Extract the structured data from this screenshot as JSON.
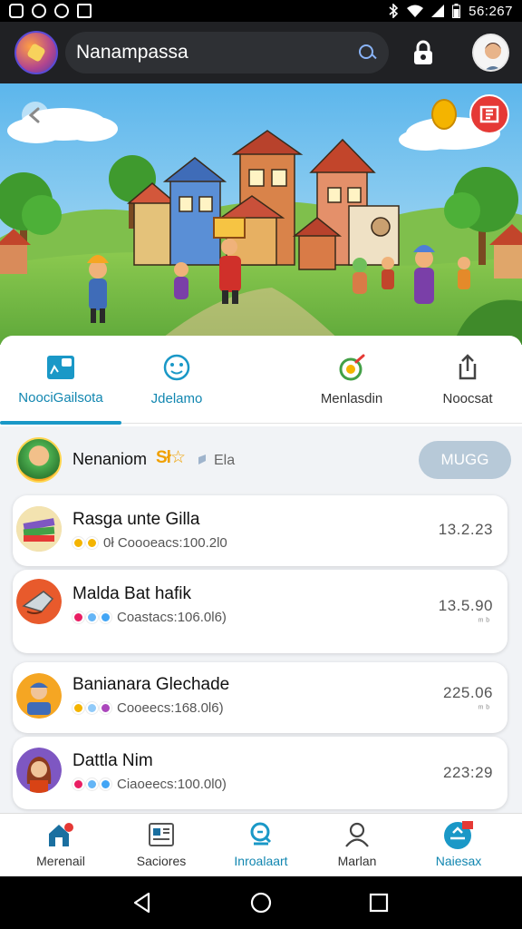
{
  "status_bar": {
    "time": "56:267",
    "left_icons": [
      "gallery-icon",
      "whatsapp-icon",
      "sync-icon",
      "mail-icon"
    ],
    "right_icons": [
      "bluetooth-icon",
      "wifi-icon",
      "signal-icon",
      "battery-icon"
    ]
  },
  "app_bar": {
    "title": "Nanampassa",
    "search_icon": "search-icon",
    "lock_icon": "lock-icon",
    "profile_icon": "profile-avatar"
  },
  "hero": {
    "back_icon": "back-arrow-icon",
    "coin_icon": "coin-icon",
    "badge_icon": "gift-badge-icon"
  },
  "tabs": [
    {
      "label": "NoociGailsota",
      "icon": "note-icon",
      "active": true
    },
    {
      "label": "Jdelamo",
      "icon": "face-icon",
      "active": false
    },
    {
      "label": "Menlasdin",
      "icon": "compass-icon",
      "active": false
    },
    {
      "label": "Noocsat",
      "icon": "share-icon",
      "active": false
    }
  ],
  "profile_row": {
    "name": "Nenaniom",
    "stars_text": "Sł☆",
    "subtitle": "Ela",
    "button_label": "MUGG"
  },
  "list": [
    {
      "name": "Rasga unte Gilla",
      "sub": "0ł  Coooeacs:100.2l0",
      "value": "13.2.23",
      "tiny": "",
      "dots": [
        "#f4b400",
        "#f4b400"
      ]
    },
    {
      "name": "Malda Bat hafik",
      "sub": "Coastacs:106.0l6)",
      "value": "13.5.90",
      "tiny": "ᵐ ᵇ",
      "dots": [
        "#e91e63",
        "#64b5f6",
        "#42a5f5"
      ]
    },
    {
      "name": "Banianara Glechade",
      "sub": "Cooeecs:168.0l6)",
      "value": "225.06",
      "tiny": "ᵐ ᵇ",
      "dots": [
        "#f4b400",
        "#90caf9",
        "#ab47bc"
      ]
    },
    {
      "name": "Dattla Nim",
      "sub": "Ciaoeecs:100.0l0)",
      "value": "223:29",
      "tiny": "",
      "dots": [
        "#e91e63",
        "#64b5f6",
        "#42a5f5"
      ]
    }
  ],
  "bottom_nav": [
    {
      "label": "Merenail",
      "icon": "home-icon",
      "active": false
    },
    {
      "label": "Saciores",
      "icon": "news-icon",
      "active": false
    },
    {
      "label": "Inroalaart",
      "icon": "search-doc-icon",
      "active": true
    },
    {
      "label": "Marlan",
      "icon": "person-icon",
      "active": false
    },
    {
      "label": "Naiesax",
      "icon": "cart-icon",
      "active": true
    }
  ],
  "colors": {
    "accent": "#1a98c7",
    "app_bar": "#202124",
    "button": "#b7c9d8",
    "background": "#f1f3f6"
  }
}
